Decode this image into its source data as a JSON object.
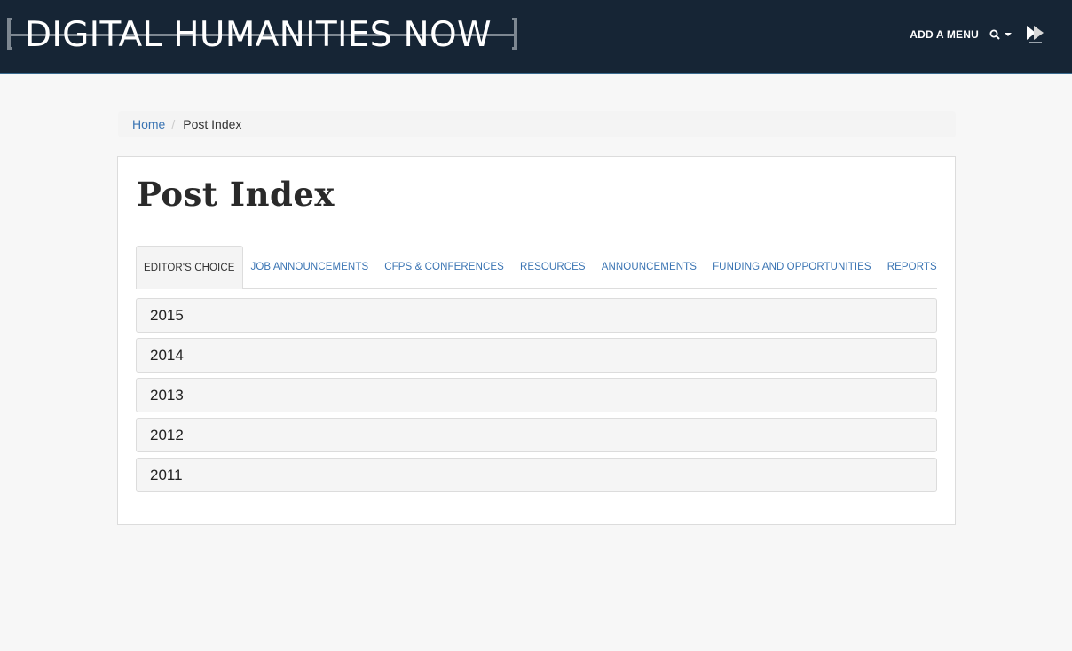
{
  "site": {
    "logo_text": "DIGITAL HUMANITIES NOW",
    "menu_label": "ADD A MENU",
    "search_icon": "search-icon",
    "publisher_icon": "press-forward-icon"
  },
  "breadcrumb": {
    "home": "Home",
    "separator": "/",
    "current": "Post Index"
  },
  "page": {
    "title": "Post Index"
  },
  "tabs": [
    {
      "label": "EDITOR'S CHOICE",
      "active": true
    },
    {
      "label": "JOB ANNOUNCEMENTS",
      "active": false
    },
    {
      "label": "CFPS & CONFERENCES",
      "active": false
    },
    {
      "label": "RESOURCES",
      "active": false
    },
    {
      "label": "ANNOUNCEMENTS",
      "active": false
    },
    {
      "label": "FUNDING AND OPPORTUNITIES",
      "active": false
    },
    {
      "label": "REPORTS",
      "active": false
    }
  ],
  "years": [
    "2015",
    "2014",
    "2013",
    "2012",
    "2011"
  ],
  "colors": {
    "header_bg": "#162535",
    "link": "#3a74b3",
    "page_bg": "#f7f7f7"
  }
}
